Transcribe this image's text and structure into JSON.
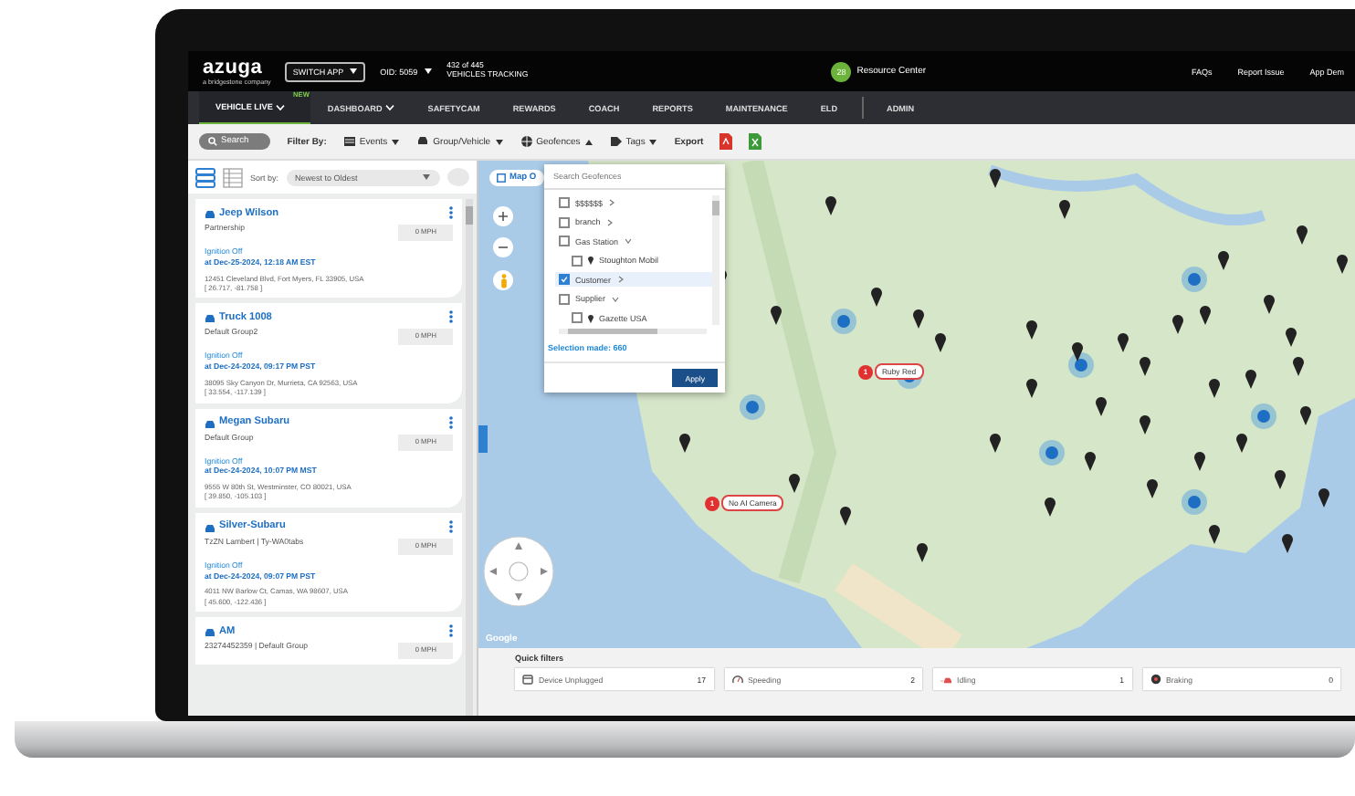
{
  "header": {
    "logo": "azuga",
    "logo_tagline": "a bridgestone company",
    "switch_app": "SWITCH APP",
    "org_id": "OID: 5059",
    "tracking_count": "432 of 445",
    "tracking_label": "VEHICLES TRACKING",
    "resource_badge": "28",
    "resource_center": "Resource Center",
    "links": [
      "FAQs",
      "Report Issue",
      "App Dem"
    ]
  },
  "nav": {
    "items": [
      {
        "label": "VEHICLE LIVE",
        "selected": true,
        "has_menu": true,
        "badge": "NEW"
      },
      {
        "label": "DASHBOARD",
        "selected": false,
        "has_menu": true
      },
      {
        "label": "SAFETYCAM",
        "selected": false,
        "has_menu": false
      },
      {
        "label": "REWARDS",
        "selected": false,
        "has_menu": false
      },
      {
        "label": "COACH",
        "selected": false,
        "has_menu": false
      },
      {
        "label": "REPORTS",
        "selected": false,
        "has_menu": false
      },
      {
        "label": "MAINTENANCE",
        "selected": false,
        "has_menu": false
      },
      {
        "label": "ELD",
        "selected": false,
        "has_menu": false
      },
      {
        "label": "ADMIN",
        "selected": false,
        "has_menu": false
      }
    ]
  },
  "filter_bar": {
    "search": "Search",
    "filter_label": "Filter By:",
    "filters": [
      {
        "label": "Events",
        "kind": "events",
        "expanded": false
      },
      {
        "label": "Group/Vehicle",
        "kind": "vehicle",
        "expanded": false
      },
      {
        "label": "Geofences",
        "kind": "geofence",
        "expanded": true
      },
      {
        "label": "Tags",
        "kind": "tags",
        "expanded": false
      }
    ],
    "export": "Export"
  },
  "vehicle_list": {
    "views": [
      {
        "kind": "cards",
        "selected": true
      },
      {
        "kind": "table",
        "selected": false
      }
    ],
    "sort_label": "Sort by:",
    "sort_value": "Newest to Oldest",
    "vehicles": [
      {
        "name": "Jeep Wilson",
        "group": "Partnership",
        "speed": "0 MPH",
        "status": "Ignition Off",
        "time": "at Dec-25-2024, 12:18 AM EST",
        "address": "12451 Cleveland Blvd, Fort Myers, FL 33905, USA",
        "coordinates": "[ 26.717, -81.758 ]"
      },
      {
        "name": "Truck 1008",
        "group": "Default Group2",
        "speed": "0 MPH",
        "status": "Ignition Off",
        "time": "at Dec-24-2024, 09:17 PM PST",
        "address": "38095 Sky Canyon Dr, Murrieta, CA 92563, USA",
        "coordinates": "[ 33.554, -117.139 ]"
      },
      {
        "name": "Megan Subaru",
        "group": "Default Group",
        "speed": "0 MPH",
        "status": "Ignition Off",
        "time": "at Dec-24-2024, 10:07 PM MST",
        "address": "9555 W 80th St, Westminster, CO 80021, USA",
        "coordinates": "[ 39.850, -105.103 ]"
      },
      {
        "name": "Silver-Subaru",
        "group": "TzZN Lambert | Ty-WA0tabs",
        "speed": "0 MPH",
        "status": "Ignition Off",
        "time": "at Dec-24-2024, 09:07 PM PST",
        "address": "4011 NW Barlow Ct, Camas, WA 98607, USA",
        "coordinates": "[ 45.600, -122.436 ]"
      },
      {
        "name": "AM",
        "group": "23274452359 | Default Group",
        "speed": "0 MPH"
      }
    ]
  },
  "geofence_menu": {
    "placeholder": "Search Geofences",
    "items": [
      {
        "label": "$$$$$$",
        "checked": false,
        "selected": false,
        "expanded": false
      },
      {
        "label": "branch",
        "checked": false,
        "selected": false,
        "expanded": false
      },
      {
        "label": "Gas Station",
        "checked": false,
        "selected": false,
        "expanded": true,
        "children": [
          {
            "label": "Stoughton Mobil",
            "checked": false,
            "selected": false
          }
        ]
      },
      {
        "label": "Customer",
        "checked": true,
        "selected": true,
        "expanded": false
      },
      {
        "label": "Supplier",
        "checked": false,
        "selected": false,
        "expanded": true,
        "children": [
          {
            "label": "Gazette USA",
            "checked": false,
            "selected": false
          }
        ]
      }
    ],
    "selection": "Selection made: 660",
    "apply": "Apply"
  },
  "map": {
    "map_button": "Map O",
    "pins": [
      {
        "label": "Ruby Red",
        "alert": "1"
      },
      {
        "label": "No AI Camera",
        "alert": "1"
      }
    ],
    "attribution": "Google"
  },
  "quick_filters": {
    "title": "Quick filters",
    "items": [
      {
        "label": "Device Unplugged",
        "count": "17",
        "kind": "unplugged"
      },
      {
        "label": "Speeding",
        "count": "2",
        "kind": "speeding"
      },
      {
        "label": "Idling",
        "count": "1",
        "kind": "idling"
      },
      {
        "label": "Braking",
        "count": "0",
        "kind": "braking"
      }
    ]
  }
}
